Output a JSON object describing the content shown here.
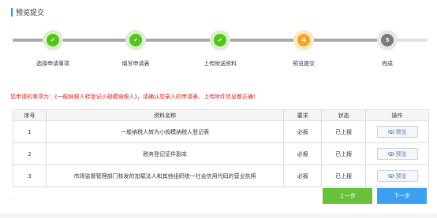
{
  "section": {
    "title": "预览提交"
  },
  "steps": [
    {
      "label": "选择申请事项",
      "status": "done",
      "number": ""
    },
    {
      "label": "填写申请表",
      "status": "done",
      "number": ""
    },
    {
      "label": "上传附送资料",
      "status": "done",
      "number": ""
    },
    {
      "label": "预览提交",
      "status": "current",
      "number": "4"
    },
    {
      "label": "完成",
      "status": "pending",
      "number": "5"
    }
  ],
  "notice": "您申请的事项为：《一般纳税人转登记小规模纳税人》，请确认您录入的申请表、上传附件信息都正确！",
  "table": {
    "headers": [
      "序号",
      "资料名称",
      "要求",
      "状态",
      "操作"
    ],
    "rows": [
      {
        "index": "1",
        "name": "一般纳税人转为小规模纳税人登记表",
        "requirement": "必报",
        "status": "已上报",
        "action": "预览"
      },
      {
        "index": "2",
        "name": "税务登记证件副本",
        "requirement": "必报",
        "status": "已上报",
        "action": "预览"
      },
      {
        "index": "3",
        "name": "市场监督管理部门核发的加载法人和其他组织统一社会信用代码的营业执照",
        "requirement": "必报",
        "status": "已上报",
        "action": "预览"
      }
    ]
  },
  "footer": {
    "dot": ".",
    "prev_label": "上一步",
    "next_label": "下一步"
  },
  "colors": {
    "accent": "#2d8cf0",
    "done": "#52c41a",
    "current": "#f5a623",
    "pending": "#7b7b7b",
    "notice": "#e02020",
    "prev_button": "#67c23a",
    "next_button": "#3c9ff0"
  }
}
